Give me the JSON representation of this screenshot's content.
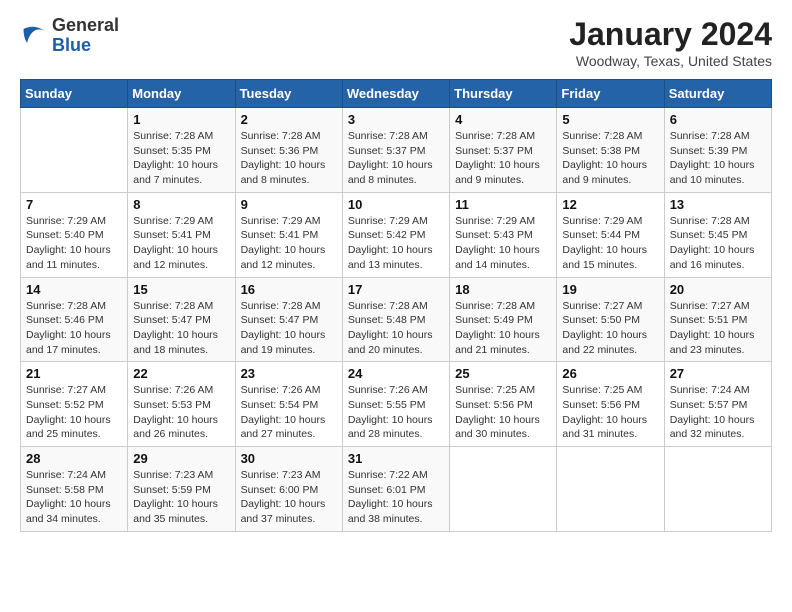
{
  "header": {
    "logo_general": "General",
    "logo_blue": "Blue",
    "title": "January 2024",
    "subtitle": "Woodway, Texas, United States"
  },
  "days_of_week": [
    "Sunday",
    "Monday",
    "Tuesday",
    "Wednesday",
    "Thursday",
    "Friday",
    "Saturday"
  ],
  "weeks": [
    [
      {
        "day": "",
        "info": ""
      },
      {
        "day": "1",
        "info": "Sunrise: 7:28 AM\nSunset: 5:35 PM\nDaylight: 10 hours\nand 7 minutes."
      },
      {
        "day": "2",
        "info": "Sunrise: 7:28 AM\nSunset: 5:36 PM\nDaylight: 10 hours\nand 8 minutes."
      },
      {
        "day": "3",
        "info": "Sunrise: 7:28 AM\nSunset: 5:37 PM\nDaylight: 10 hours\nand 8 minutes."
      },
      {
        "day": "4",
        "info": "Sunrise: 7:28 AM\nSunset: 5:37 PM\nDaylight: 10 hours\nand 9 minutes."
      },
      {
        "day": "5",
        "info": "Sunrise: 7:28 AM\nSunset: 5:38 PM\nDaylight: 10 hours\nand 9 minutes."
      },
      {
        "day": "6",
        "info": "Sunrise: 7:28 AM\nSunset: 5:39 PM\nDaylight: 10 hours\nand 10 minutes."
      }
    ],
    [
      {
        "day": "7",
        "info": "Sunrise: 7:29 AM\nSunset: 5:40 PM\nDaylight: 10 hours\nand 11 minutes."
      },
      {
        "day": "8",
        "info": "Sunrise: 7:29 AM\nSunset: 5:41 PM\nDaylight: 10 hours\nand 12 minutes."
      },
      {
        "day": "9",
        "info": "Sunrise: 7:29 AM\nSunset: 5:41 PM\nDaylight: 10 hours\nand 12 minutes."
      },
      {
        "day": "10",
        "info": "Sunrise: 7:29 AM\nSunset: 5:42 PM\nDaylight: 10 hours\nand 13 minutes."
      },
      {
        "day": "11",
        "info": "Sunrise: 7:29 AM\nSunset: 5:43 PM\nDaylight: 10 hours\nand 14 minutes."
      },
      {
        "day": "12",
        "info": "Sunrise: 7:29 AM\nSunset: 5:44 PM\nDaylight: 10 hours\nand 15 minutes."
      },
      {
        "day": "13",
        "info": "Sunrise: 7:28 AM\nSunset: 5:45 PM\nDaylight: 10 hours\nand 16 minutes."
      }
    ],
    [
      {
        "day": "14",
        "info": "Sunrise: 7:28 AM\nSunset: 5:46 PM\nDaylight: 10 hours\nand 17 minutes."
      },
      {
        "day": "15",
        "info": "Sunrise: 7:28 AM\nSunset: 5:47 PM\nDaylight: 10 hours\nand 18 minutes."
      },
      {
        "day": "16",
        "info": "Sunrise: 7:28 AM\nSunset: 5:47 PM\nDaylight: 10 hours\nand 19 minutes."
      },
      {
        "day": "17",
        "info": "Sunrise: 7:28 AM\nSunset: 5:48 PM\nDaylight: 10 hours\nand 20 minutes."
      },
      {
        "day": "18",
        "info": "Sunrise: 7:28 AM\nSunset: 5:49 PM\nDaylight: 10 hours\nand 21 minutes."
      },
      {
        "day": "19",
        "info": "Sunrise: 7:27 AM\nSunset: 5:50 PM\nDaylight: 10 hours\nand 22 minutes."
      },
      {
        "day": "20",
        "info": "Sunrise: 7:27 AM\nSunset: 5:51 PM\nDaylight: 10 hours\nand 23 minutes."
      }
    ],
    [
      {
        "day": "21",
        "info": "Sunrise: 7:27 AM\nSunset: 5:52 PM\nDaylight: 10 hours\nand 25 minutes."
      },
      {
        "day": "22",
        "info": "Sunrise: 7:26 AM\nSunset: 5:53 PM\nDaylight: 10 hours\nand 26 minutes."
      },
      {
        "day": "23",
        "info": "Sunrise: 7:26 AM\nSunset: 5:54 PM\nDaylight: 10 hours\nand 27 minutes."
      },
      {
        "day": "24",
        "info": "Sunrise: 7:26 AM\nSunset: 5:55 PM\nDaylight: 10 hours\nand 28 minutes."
      },
      {
        "day": "25",
        "info": "Sunrise: 7:25 AM\nSunset: 5:56 PM\nDaylight: 10 hours\nand 30 minutes."
      },
      {
        "day": "26",
        "info": "Sunrise: 7:25 AM\nSunset: 5:56 PM\nDaylight: 10 hours\nand 31 minutes."
      },
      {
        "day": "27",
        "info": "Sunrise: 7:24 AM\nSunset: 5:57 PM\nDaylight: 10 hours\nand 32 minutes."
      }
    ],
    [
      {
        "day": "28",
        "info": "Sunrise: 7:24 AM\nSunset: 5:58 PM\nDaylight: 10 hours\nand 34 minutes."
      },
      {
        "day": "29",
        "info": "Sunrise: 7:23 AM\nSunset: 5:59 PM\nDaylight: 10 hours\nand 35 minutes."
      },
      {
        "day": "30",
        "info": "Sunrise: 7:23 AM\nSunset: 6:00 PM\nDaylight: 10 hours\nand 37 minutes."
      },
      {
        "day": "31",
        "info": "Sunrise: 7:22 AM\nSunset: 6:01 PM\nDaylight: 10 hours\nand 38 minutes."
      },
      {
        "day": "",
        "info": ""
      },
      {
        "day": "",
        "info": ""
      },
      {
        "day": "",
        "info": ""
      }
    ]
  ]
}
